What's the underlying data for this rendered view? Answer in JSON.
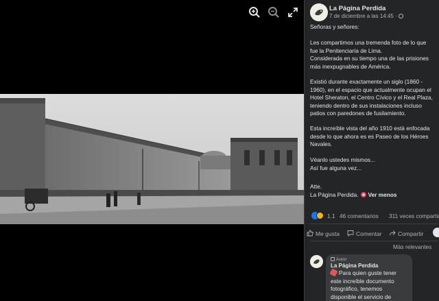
{
  "viewer": {
    "toolbar": [
      {
        "name": "zoom-in"
      },
      {
        "name": "zoom-out"
      },
      {
        "name": "fullscreen"
      }
    ]
  },
  "post": {
    "page_name": "La Página Perdida",
    "timestamp": "7 de diciembre a las 14:45 ·",
    "audience_icon": "globe-icon",
    "paragraphs": [
      "Señoras y señores:",
      "Les compartimos una tremenda foto de lo que\nfue la Penitenciaría de Lima.\nConsiderada en su tiempo una de las prisiones\nmás inexpugnables de América.",
      "Existió durante exactamente un siglo (1860 -\n1960), en el espacio que actualmente ocupan el\nHotel Sheraton, el Centro Cívico y el Real Plaza,\nteniendo dentro de sus instalaciones incluso\npatios con paredones de fusilamiento.",
      "Esta increíble vista del año 1910 está enfocada\ndesde lo que ahora es es Paseo de los Héroes\nNavales.",
      "Véanlo ustedes mismos...\nAsí fue alguna vez...",
      "Atte.\nLa Página Perdida."
    ],
    "see_less": "Ver menos"
  },
  "stats": {
    "reaction_count": "1.1",
    "comments": "46 comentarios",
    "shares": "311 veces compartido"
  },
  "actions": {
    "like": "Me gusta",
    "comment": "Comentar",
    "share": "Compartir"
  },
  "comments": {
    "sort_label": "Más relevantes",
    "items": [
      {
        "badge": "Autor",
        "author": "La Página Perdida",
        "text": "Para quien guste tener\neste increíble documento\nfotográfico, tenemos\ndisponible el servicio de"
      }
    ]
  },
  "colors": {
    "panel_bg": "#242526",
    "bubble_bg": "#3a3b3c",
    "text_primary": "#e4e6eb",
    "text_secondary": "#b0b3b8",
    "like_blue": "#1877f2"
  }
}
